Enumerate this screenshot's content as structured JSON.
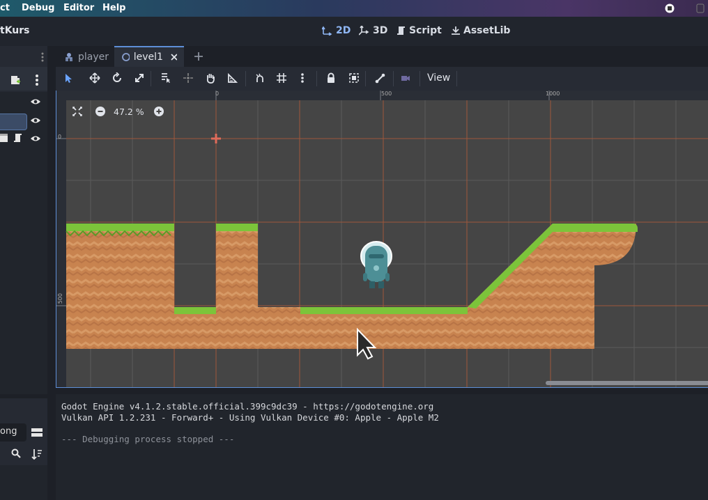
{
  "menu": {
    "items": [
      "ct",
      "Debug",
      "Editor",
      "Help"
    ]
  },
  "project": {
    "name": "tKurs"
  },
  "workspaces": [
    "2D",
    "3D",
    "Script",
    "AssetLib"
  ],
  "tabs": [
    {
      "label": "player",
      "active": false
    },
    {
      "label": "level1",
      "active": true
    }
  ],
  "toolbar": {
    "view_label": "View"
  },
  "viewport": {
    "zoom": "47.2 %",
    "ruler_top": [
      "0",
      "500",
      "1000"
    ],
    "ruler_left": [
      "0",
      "500"
    ]
  },
  "left_panel": {
    "filter_text": "ong"
  },
  "output": {
    "lines": [
      "Godot Engine v4.1.2.stable.official.399c9dc39 - https://godotengine.org",
      "Vulkan API 1.2.231 - Forward+ - Using Vulkan Device #0: Apple - Apple M2",
      "",
      "--- Debugging process stopped ---"
    ]
  },
  "colors": {
    "accent": "#6aa3ff",
    "grass": "#7cc43a",
    "dirt": "#c8834f",
    "canvas": "#454545"
  }
}
